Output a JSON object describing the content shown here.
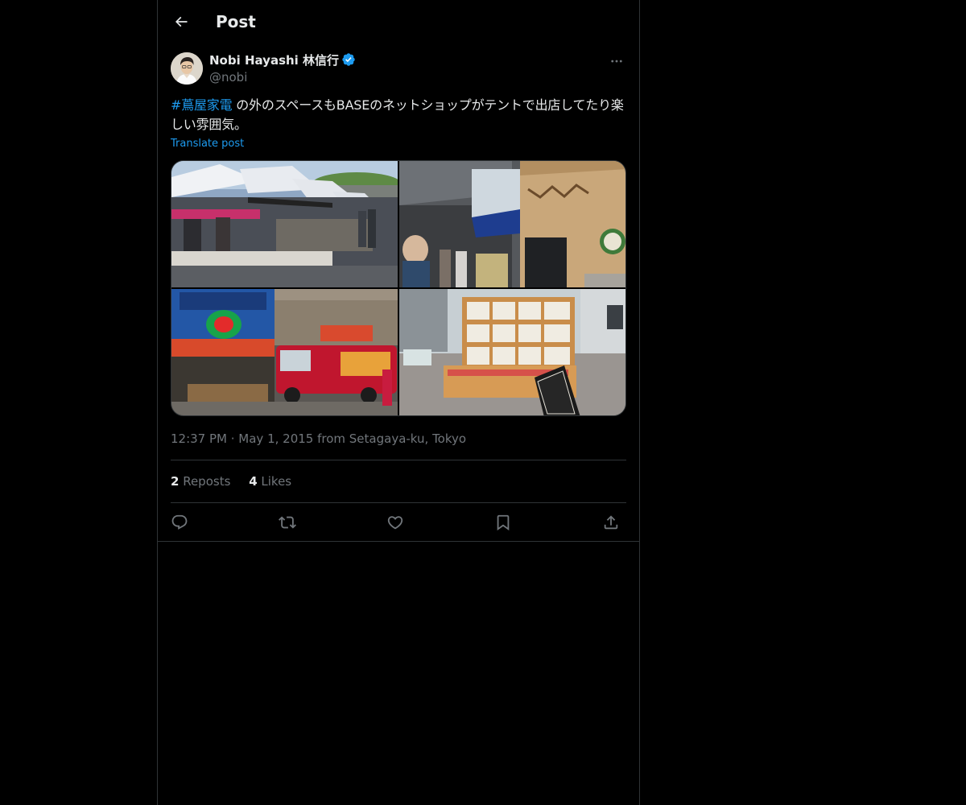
{
  "header": {
    "title": "Post",
    "back_icon": "arrow-left-icon"
  },
  "author": {
    "display_name": "Nobi Hayashi 林信行",
    "handle": "@nobi",
    "verified": true,
    "verified_color": "#1d9bf0"
  },
  "post": {
    "hashtag": "#蔦屋家電",
    "text": " の外のスペースもBASEのネットショップがテントで出店してたり楽しい雰囲気。",
    "translate_label": "Translate post",
    "media_count": 4
  },
  "meta": {
    "time": "12:37 PM",
    "separator": " · ",
    "date": "May 1, 2015",
    "location": " from Setagaya-ku, Tokyo"
  },
  "stats": {
    "reposts_count": "2",
    "reposts_label": " Reposts",
    "likes_count": "4",
    "likes_label": " Likes"
  },
  "actions": [
    "reply-icon",
    "repost-icon",
    "like-icon",
    "bookmark-icon",
    "share-icon"
  ],
  "colors": {
    "background": "#000000",
    "text_primary": "#e7e9ea",
    "text_secondary": "#71767b",
    "accent": "#1d9bf0",
    "border": "#2f3336"
  }
}
